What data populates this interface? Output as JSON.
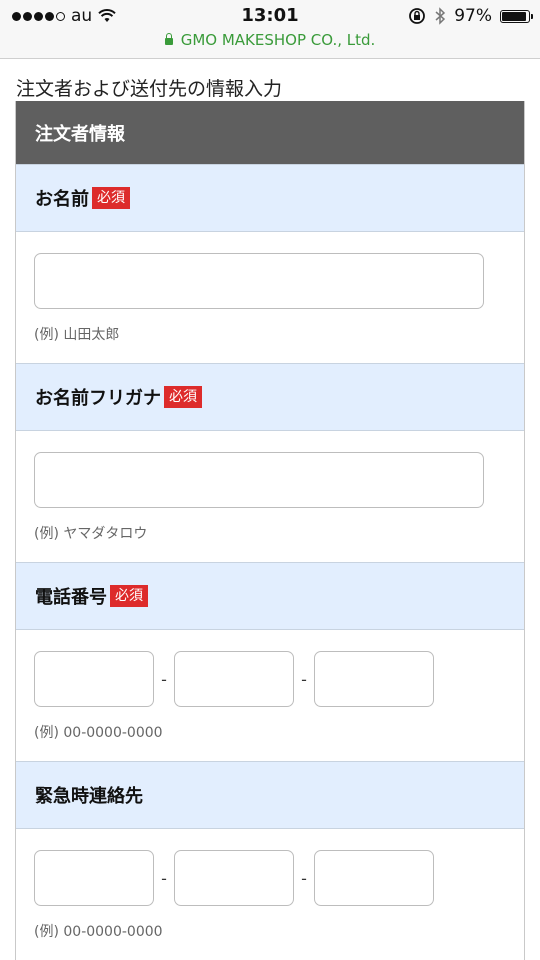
{
  "status_bar": {
    "carrier": "au",
    "time": "13:01",
    "battery": "97%",
    "battery_level": 0.97,
    "url": "GMO MAKESHOP CO., Ltd."
  },
  "page": {
    "heading": "注文者および送付先の情報入力"
  },
  "section": {
    "title": "注文者情報"
  },
  "required_badge": "必須",
  "fields": {
    "name": {
      "label": "お名前",
      "example": "(例) 山田太郎",
      "value": ""
    },
    "furigana": {
      "label": "お名前フリガナ",
      "example": "(例) ヤマダタロウ",
      "value": ""
    },
    "phone": {
      "label": "電話番号",
      "separator": "-",
      "example": "(例) 00-0000-0000"
    },
    "emergency": {
      "label": "緊急時連絡先",
      "separator": "-",
      "example": "(例) 00-0000-0000"
    }
  },
  "colors": {
    "header_bg": "#5f5f5f",
    "label_bg": "#e2eefe",
    "required_bg": "#dd2b2b",
    "url_green": "#3a9b3a"
  }
}
